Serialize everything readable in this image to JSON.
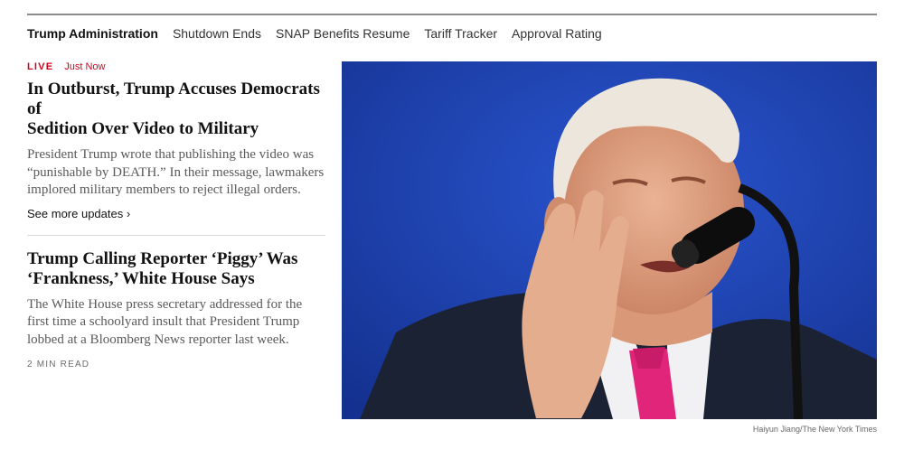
{
  "nav": {
    "title": "Trump Administration",
    "items": [
      "Shutdown Ends",
      "SNAP Benefits Resume",
      "Tariff Tracker",
      "Approval Rating"
    ]
  },
  "story1": {
    "live_label": "LIVE",
    "timestamp": "Just Now",
    "headline_line1": "In Outburst, Trump Accuses Democrats of",
    "headline_line2": "Sedition Over Video to Military",
    "summary": "President Trump wrote that publishing the video was “punishable by DEATH.” In their message, lawmakers implored military members to reject illegal orders.",
    "see_more": "See more updates ›"
  },
  "story2": {
    "headline_line1": "Trump Calling Reporter ‘Piggy’ Was",
    "headline_line2": "‘Frankness,’ White House Says",
    "summary": "The White House press secretary addressed for the first time a schoolyard insult that President Trump lobbed at a Bloomberg News reporter last week.",
    "read_time": "2 MIN READ"
  },
  "photo": {
    "credit": "Haiyun Jiang/The New York Times",
    "colors": {
      "background": "#1a3fb0",
      "suit": "#1b2234",
      "tie": "#e0257a",
      "skin": "#e2a585",
      "hair": "#ece6dc"
    }
  }
}
